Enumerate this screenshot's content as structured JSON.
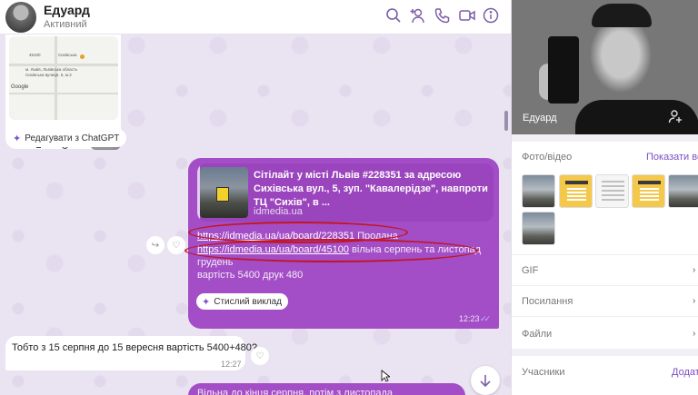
{
  "header": {
    "name": "Едуард",
    "status": "Активний"
  },
  "map_card": {
    "time": "11:37",
    "map_label_1": "45100",
    "map_label_2": "Сихівська",
    "map_label_3": "м. Львів, Львівська область",
    "map_label_4": "Сихівська вулиця, 5, м.2",
    "map_brand": "Google"
  },
  "gpt_button": "Редагувати з ChatGPT",
  "sent_message": {
    "preview_title": "Сітілайт у місті Львів #228351 за адресою Сихівська вул., 5, зуп. \"Кавалерідзе\", навпроти ТЦ \"Сихів\", в ...",
    "preview_domain": "idmedia.ua",
    "line1_link": "https://idmedia.ua/ua/board/228351",
    "line1_suffix": " Продана",
    "line2_link": "https://idmedia.ua/ua/board/45100",
    "line2_suffix": " вільна серпень та листопад",
    "line3": "грудень",
    "line4": "вартість 5400 друк 480",
    "ai_button": "Стислий виклад",
    "time": "12:23"
  },
  "received_message": {
    "text": "Тобто з 15 серпня до 15 вересня вартість 5400+480?",
    "time": "12:27"
  },
  "sent_message_2": {
    "text": "Вільна до кінця серпня, потім з листопада"
  },
  "panel": {
    "photo_name": "Едуард",
    "media_label": "Фото/відео",
    "media_link": "Показати всі",
    "gif_label": "GIF",
    "links_label": "Посилання",
    "files_label": "Файли",
    "members_label": "Учасники",
    "members_link": "Додати"
  },
  "colors": {
    "bubble_sent": "#a34ec6",
    "accent": "#7d5ea8",
    "annotation": "#c01624"
  }
}
